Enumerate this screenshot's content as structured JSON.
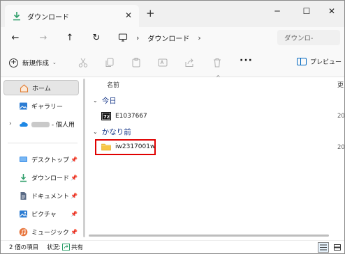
{
  "window": {
    "tab_title": "ダウンロード",
    "tab_close": "✕",
    "new_tab": "+",
    "minimize": "─",
    "maximize": "☐",
    "close": "✕"
  },
  "address": {
    "back": "←",
    "forward": "→",
    "up": "↑",
    "refresh": "↻",
    "separator": "›",
    "current": "ダウンロード",
    "trailing_separator": "›",
    "search_placeholder": "ダウンロ-"
  },
  "toolbar": {
    "new_label": "新規作成",
    "new_chevron": "⌄",
    "more": "···",
    "preview_label": "プレビュー"
  },
  "sidebar": {
    "home": "ホーム",
    "gallery": "ギャラリー",
    "onedrive": "- 個人用",
    "desktop": "デスクトップ",
    "downloads": "ダウンロード",
    "documents": "ドキュメント",
    "pictures": "ピクチャ",
    "music": "ミュージック",
    "pin": "📌",
    "expander": "›"
  },
  "content": {
    "column_name": "名前",
    "column_second": "更",
    "sort_caret": "^",
    "groups": [
      {
        "label": "今日",
        "chevron": "⌄"
      },
      {
        "label": "かなり前",
        "chevron": "⌄"
      }
    ],
    "files": [
      {
        "name": "E1037667",
        "icon": "7z-archive-icon",
        "date": "20"
      },
      {
        "name": "iw2317001w",
        "icon": "folder-icon",
        "date": "20"
      }
    ]
  },
  "status": {
    "item_count": "2 個の項目",
    "state_label": "状況:",
    "state_value": "共有"
  },
  "colors": {
    "accent": "#0067c0",
    "highlight": "#e00000",
    "folder": "#f8c644",
    "downloads": "#2e9e6a"
  }
}
